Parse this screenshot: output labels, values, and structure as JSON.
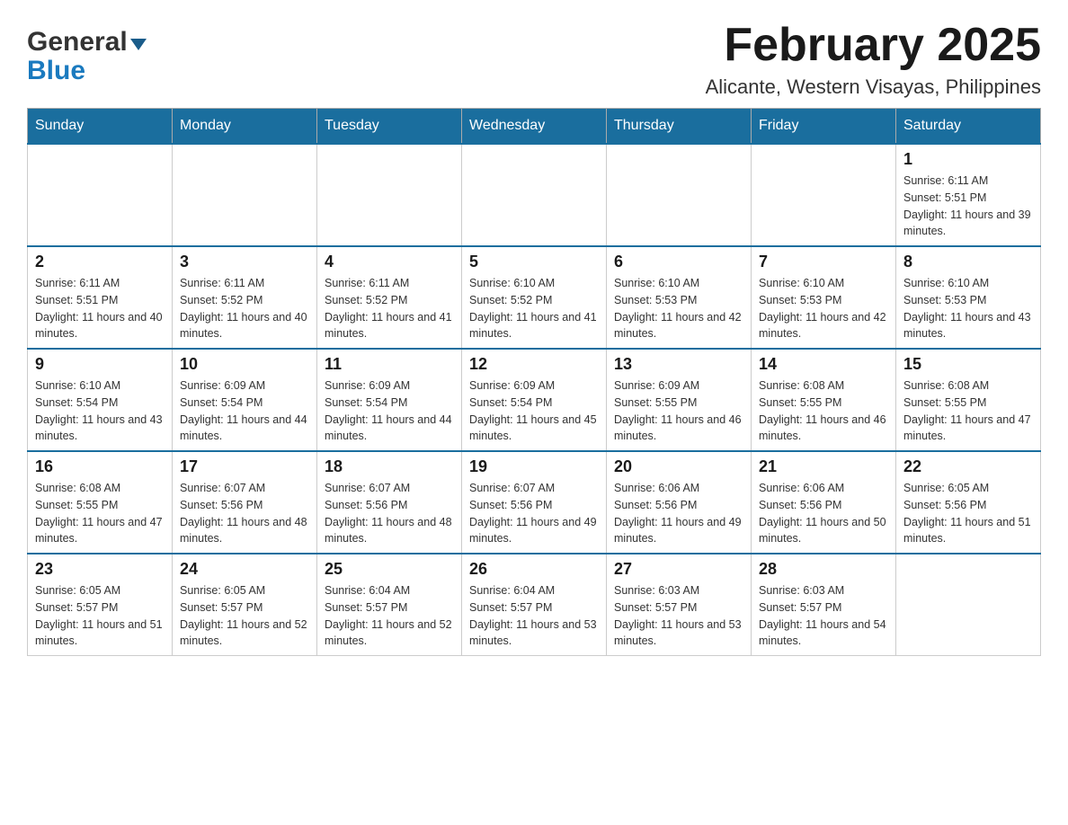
{
  "header": {
    "logo_general": "General",
    "logo_blue": "Blue",
    "title": "February 2025",
    "subtitle": "Alicante, Western Visayas, Philippines"
  },
  "calendar": {
    "days_of_week": [
      "Sunday",
      "Monday",
      "Tuesday",
      "Wednesday",
      "Thursday",
      "Friday",
      "Saturday"
    ],
    "weeks": [
      [
        {
          "day": "",
          "info": ""
        },
        {
          "day": "",
          "info": ""
        },
        {
          "day": "",
          "info": ""
        },
        {
          "day": "",
          "info": ""
        },
        {
          "day": "",
          "info": ""
        },
        {
          "day": "",
          "info": ""
        },
        {
          "day": "1",
          "info": "Sunrise: 6:11 AM\nSunset: 5:51 PM\nDaylight: 11 hours and 39 minutes."
        }
      ],
      [
        {
          "day": "2",
          "info": "Sunrise: 6:11 AM\nSunset: 5:51 PM\nDaylight: 11 hours and 40 minutes."
        },
        {
          "day": "3",
          "info": "Sunrise: 6:11 AM\nSunset: 5:52 PM\nDaylight: 11 hours and 40 minutes."
        },
        {
          "day": "4",
          "info": "Sunrise: 6:11 AM\nSunset: 5:52 PM\nDaylight: 11 hours and 41 minutes."
        },
        {
          "day": "5",
          "info": "Sunrise: 6:10 AM\nSunset: 5:52 PM\nDaylight: 11 hours and 41 minutes."
        },
        {
          "day": "6",
          "info": "Sunrise: 6:10 AM\nSunset: 5:53 PM\nDaylight: 11 hours and 42 minutes."
        },
        {
          "day": "7",
          "info": "Sunrise: 6:10 AM\nSunset: 5:53 PM\nDaylight: 11 hours and 42 minutes."
        },
        {
          "day": "8",
          "info": "Sunrise: 6:10 AM\nSunset: 5:53 PM\nDaylight: 11 hours and 43 minutes."
        }
      ],
      [
        {
          "day": "9",
          "info": "Sunrise: 6:10 AM\nSunset: 5:54 PM\nDaylight: 11 hours and 43 minutes."
        },
        {
          "day": "10",
          "info": "Sunrise: 6:09 AM\nSunset: 5:54 PM\nDaylight: 11 hours and 44 minutes."
        },
        {
          "day": "11",
          "info": "Sunrise: 6:09 AM\nSunset: 5:54 PM\nDaylight: 11 hours and 44 minutes."
        },
        {
          "day": "12",
          "info": "Sunrise: 6:09 AM\nSunset: 5:54 PM\nDaylight: 11 hours and 45 minutes."
        },
        {
          "day": "13",
          "info": "Sunrise: 6:09 AM\nSunset: 5:55 PM\nDaylight: 11 hours and 46 minutes."
        },
        {
          "day": "14",
          "info": "Sunrise: 6:08 AM\nSunset: 5:55 PM\nDaylight: 11 hours and 46 minutes."
        },
        {
          "day": "15",
          "info": "Sunrise: 6:08 AM\nSunset: 5:55 PM\nDaylight: 11 hours and 47 minutes."
        }
      ],
      [
        {
          "day": "16",
          "info": "Sunrise: 6:08 AM\nSunset: 5:55 PM\nDaylight: 11 hours and 47 minutes."
        },
        {
          "day": "17",
          "info": "Sunrise: 6:07 AM\nSunset: 5:56 PM\nDaylight: 11 hours and 48 minutes."
        },
        {
          "day": "18",
          "info": "Sunrise: 6:07 AM\nSunset: 5:56 PM\nDaylight: 11 hours and 48 minutes."
        },
        {
          "day": "19",
          "info": "Sunrise: 6:07 AM\nSunset: 5:56 PM\nDaylight: 11 hours and 49 minutes."
        },
        {
          "day": "20",
          "info": "Sunrise: 6:06 AM\nSunset: 5:56 PM\nDaylight: 11 hours and 49 minutes."
        },
        {
          "day": "21",
          "info": "Sunrise: 6:06 AM\nSunset: 5:56 PM\nDaylight: 11 hours and 50 minutes."
        },
        {
          "day": "22",
          "info": "Sunrise: 6:05 AM\nSunset: 5:56 PM\nDaylight: 11 hours and 51 minutes."
        }
      ],
      [
        {
          "day": "23",
          "info": "Sunrise: 6:05 AM\nSunset: 5:57 PM\nDaylight: 11 hours and 51 minutes."
        },
        {
          "day": "24",
          "info": "Sunrise: 6:05 AM\nSunset: 5:57 PM\nDaylight: 11 hours and 52 minutes."
        },
        {
          "day": "25",
          "info": "Sunrise: 6:04 AM\nSunset: 5:57 PM\nDaylight: 11 hours and 52 minutes."
        },
        {
          "day": "26",
          "info": "Sunrise: 6:04 AM\nSunset: 5:57 PM\nDaylight: 11 hours and 53 minutes."
        },
        {
          "day": "27",
          "info": "Sunrise: 6:03 AM\nSunset: 5:57 PM\nDaylight: 11 hours and 53 minutes."
        },
        {
          "day": "28",
          "info": "Sunrise: 6:03 AM\nSunset: 5:57 PM\nDaylight: 11 hours and 54 minutes."
        },
        {
          "day": "",
          "info": ""
        }
      ]
    ]
  }
}
